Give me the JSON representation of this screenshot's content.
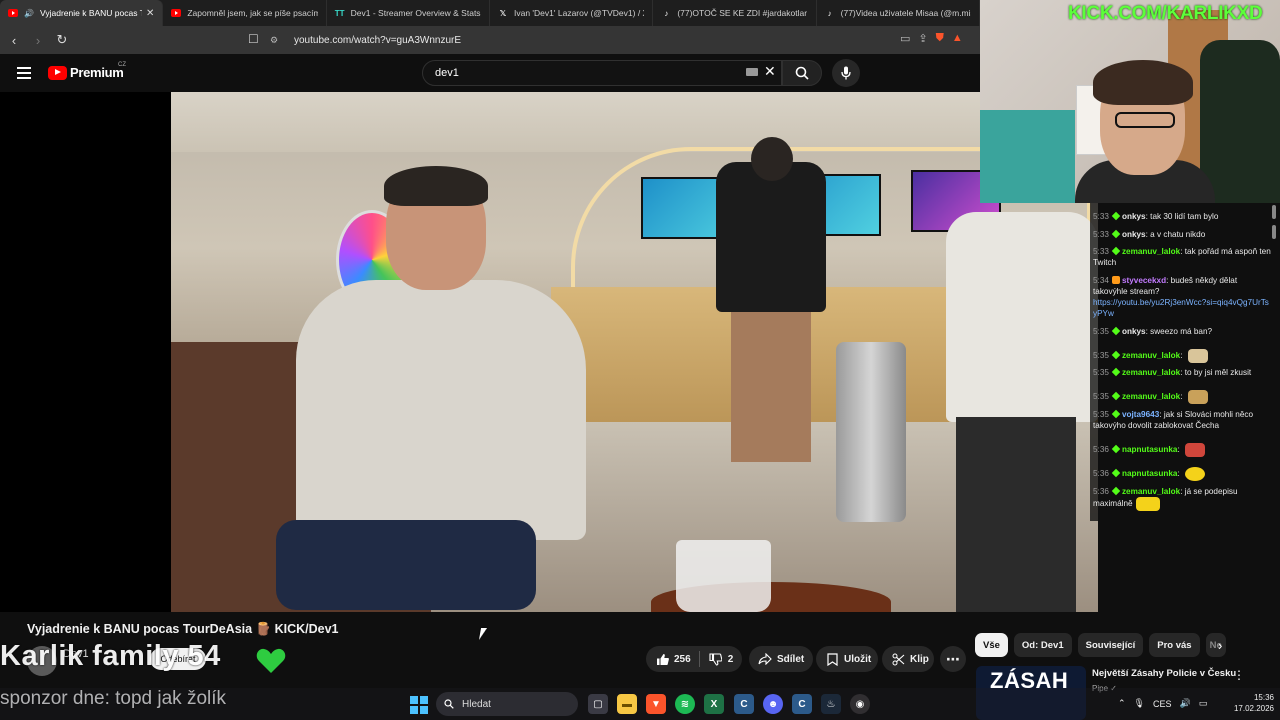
{
  "browser": {
    "tabs": [
      {
        "title": "Vyjadrenie k BANU pocas Tou",
        "favicon": "youtube-icon",
        "active": true
      },
      {
        "title": "Zapomněl jsem, jak se píše psacím...",
        "favicon": "youtube-icon",
        "active": false
      },
      {
        "title": "Dev1 - Streamer Overview & Stats - T",
        "favicon": "tt-icon",
        "active": false
      },
      {
        "title": "Ivan 'Dev1' Lazarov (@TVDev1) / X",
        "favicon": "x-icon",
        "active": false
      },
      {
        "title": "(77)OTOČ SE KE ZDI #jardakotlar #k",
        "favicon": "tiktok-icon",
        "active": false
      },
      {
        "title": "(77)Videa uživatele Misaa (@m.misa",
        "favicon": "tiktok-icon",
        "active": false
      }
    ],
    "url": "youtube.com/watch?v=guA3WnnzurE"
  },
  "youtube": {
    "logo_text": "Premium",
    "country_code": "CZ",
    "search_value": "dev1"
  },
  "video": {
    "title": "Vyjadrenie k BANU pocas TourDeAsia 🪵 KICK/Dev1",
    "channel_name": "Dev1",
    "subscribe_label": "Odebírat",
    "likes": "256",
    "dislikes": "2",
    "share_label": "Sdílet",
    "save_label": "Uložit",
    "clip_label": "Klip",
    "more_label": "⋯"
  },
  "stream_overlay": {
    "kick_url": "KICK.COM/KARLIKXD",
    "family_text": "Karlik family 54",
    "sponsor_text": "sponzor dne: topd jak žolík",
    "heart_color": "#2ecc40"
  },
  "chat": {
    "messages": [
      {
        "time": "5:33",
        "user": "onkys",
        "user_color": "#e9e9e9",
        "badge": "green",
        "text": "tak 30 lidí tam bylo"
      },
      {
        "time": "5:33",
        "user": "onkys",
        "user_color": "#e9e9e9",
        "badge": "green",
        "text": "a v chatu nikdo"
      },
      {
        "time": "5:33",
        "user": "zemanuv_lalok",
        "user_color": "#53fc18",
        "badge": "green",
        "text": "tak pořád má aspoň ten Twitch"
      },
      {
        "time": "5:34",
        "user": "styvecekxd",
        "user_color": "#c27bff",
        "badge": "orange",
        "text": "budeš někdy dělat takovýhle stream?",
        "link": "https://youtu.be/yu2Rj3enWcc?si=qiq4vQg7UrTsyPYw"
      },
      {
        "time": "5:35",
        "user": "onkys",
        "user_color": "#e9e9e9",
        "badge": "green",
        "text": "sweezo má ban?"
      },
      {
        "time": "5:35",
        "user": "zemanuv_lalok",
        "user_color": "#53fc18",
        "badge": "green",
        "text": "",
        "emote": "cat-emote"
      },
      {
        "time": "5:35",
        "user": "zemanuv_lalok",
        "user_color": "#53fc18",
        "badge": "green",
        "text": "to by jsi měl zkusit"
      },
      {
        "time": "5:35",
        "user": "zemanuv_lalok",
        "user_color": "#53fc18",
        "badge": "green",
        "text": "",
        "emote": "doge-emote"
      },
      {
        "time": "5:35",
        "user": "vojta9643",
        "user_color": "#7bb3ff",
        "badge": "green",
        "text": "jak si Slováci mohli něco takovýho dovolit zablokovat Čecha"
      },
      {
        "time": "5:36",
        "user": "napnutasunka",
        "user_color": "#53fc18",
        "badge": "green",
        "text": "",
        "emote": "lips-emote"
      },
      {
        "time": "5:36",
        "user": "napnutasunka",
        "user_color": "#53fc18",
        "badge": "green",
        "text": "",
        "emote": "smiley-emote"
      },
      {
        "time": "5:36",
        "user": "zemanuv_lalok",
        "user_color": "#53fc18",
        "badge": "green",
        "text": "já se podepisu maximálně",
        "emote": "laugh-emote"
      }
    ]
  },
  "sidebar": {
    "chips": [
      "Vše",
      "Od: Dev1",
      "Související",
      "Pro vás",
      "Ne"
    ],
    "recommended": {
      "thumb_text": "ZÁSAH",
      "title": "Největší Zásahy Policie v Česku",
      "subtitle": "Pipe ✓"
    }
  },
  "taskbar": {
    "search_placeholder": "Hledat",
    "language": "CES",
    "time": "15:36",
    "date": "17.02.2026"
  },
  "colors": {
    "kick_green": "#53fc18",
    "youtube_red": "#ff0000",
    "background": "#0f0f0f"
  }
}
